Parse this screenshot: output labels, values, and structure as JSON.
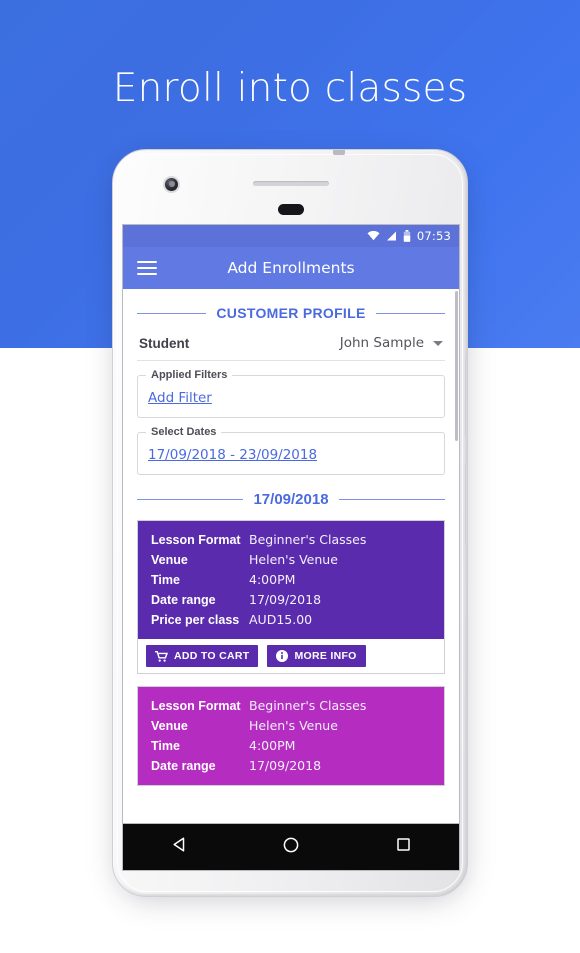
{
  "page": {
    "headline": "Enroll into classes",
    "bg_blue": "#3f74ef"
  },
  "status_bar": {
    "time": "07:53",
    "icons": [
      "wifi-icon",
      "signal-icon",
      "battery-icon"
    ]
  },
  "app_bar": {
    "menu_icon": "hamburger-menu-icon",
    "title": "Add Enrollments"
  },
  "sections": {
    "customer_profile_label": "CUSTOMER PROFILE",
    "date_label": "17/09/2018"
  },
  "student_field": {
    "label": "Student",
    "value": "John Sample",
    "dropdown_icon": "chevron-down-icon"
  },
  "applied_filters": {
    "legend": "Applied Filters",
    "link": "Add Filter"
  },
  "select_dates": {
    "legend": "Select Dates",
    "value": "17/09/2018 - 23/09/2018"
  },
  "cards": [
    {
      "color": "#5b2bae",
      "rows": [
        {
          "key": "Lesson Format",
          "value": "Beginner's Classes"
        },
        {
          "key": "Venue",
          "value": "Helen's Venue"
        },
        {
          "key": "Time",
          "value": "4:00PM"
        },
        {
          "key": "Date range",
          "value": "17/09/2018"
        },
        {
          "key": "Price per class",
          "value": "AUD15.00"
        }
      ],
      "actions": [
        {
          "label": "ADD TO CART",
          "icon": "shopping-cart-icon"
        },
        {
          "label": "MORE INFO",
          "icon": "info-icon"
        }
      ]
    },
    {
      "color": "#b52cc0",
      "rows": [
        {
          "key": "Lesson Format",
          "value": "Beginner's Classes"
        },
        {
          "key": "Venue",
          "value": "Helen's Venue"
        },
        {
          "key": "Time",
          "value": "4:00PM"
        },
        {
          "key": "Date range",
          "value": "17/09/2018"
        }
      ],
      "actions": []
    }
  ],
  "nav_bar": {
    "back": "back-triangle-icon",
    "home": "home-circle-icon",
    "recents": "recents-square-icon"
  }
}
